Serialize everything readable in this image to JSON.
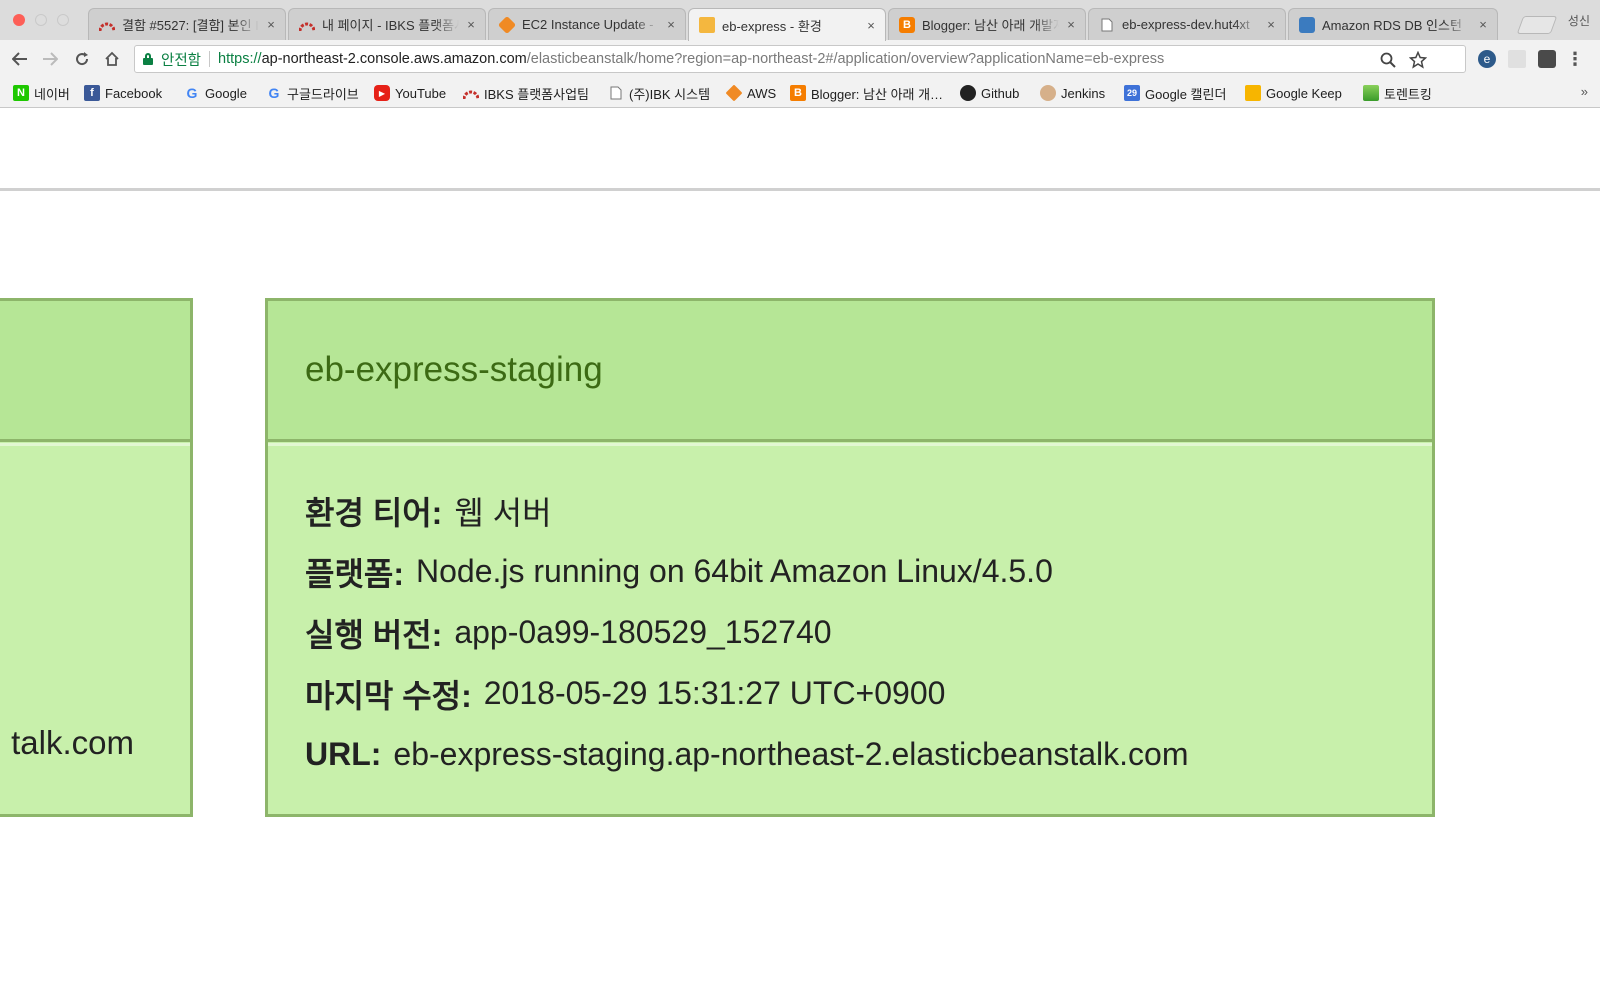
{
  "browser": {
    "tabs": [
      {
        "title": "결함 #5527: [결함] 본인 I",
        "favicon": "redmine-icon",
        "active": false
      },
      {
        "title": "내 페이지 - IBKS 플랫폼사",
        "favicon": "redmine-icon",
        "active": false
      },
      {
        "title": "EC2 Instance Update -",
        "favicon": "aws-icon",
        "active": false
      },
      {
        "title": "eb-express - 환경",
        "favicon": "beanstalk-icon",
        "active": true
      },
      {
        "title": "Blogger: 남산 아래 개발지",
        "favicon": "blogger-icon",
        "active": false
      },
      {
        "title": "eb-express-dev.hut4xt",
        "favicon": "page-icon",
        "active": false
      },
      {
        "title": "Amazon RDS DB 인스턴",
        "favicon": "rds-icon",
        "active": false
      }
    ],
    "close_glyph": "×",
    "profile_name": "성신",
    "address": {
      "secure_label": "안전함",
      "scheme": "https://",
      "host": "ap-northeast-2.console.aws.amazon.com",
      "path": "/elasticbeanstalk/home?region=ap-northeast-2#/application/overview?applicationName=eb-express"
    },
    "bookmarks": [
      {
        "label": "네이버",
        "icon": "naver-icon"
      },
      {
        "label": "Facebook",
        "icon": "facebook-icon"
      },
      {
        "label": "Google",
        "icon": "google-icon"
      },
      {
        "label": "구글드라이브",
        "icon": "google-icon"
      },
      {
        "label": "YouTube",
        "icon": "youtube-icon"
      },
      {
        "label": "IBKS 플랫폼사업팀",
        "icon": "redmine-icon"
      },
      {
        "label": "(주)IBK 시스템",
        "icon": "page-icon"
      },
      {
        "label": "AWS",
        "icon": "aws-icon"
      },
      {
        "label": "Blogger: 남산 아래 개…",
        "icon": "blogger-icon"
      },
      {
        "label": "Github",
        "icon": "github-icon"
      },
      {
        "label": "Jenkins",
        "icon": "jenkins-icon"
      },
      {
        "label": "Google 캘린더",
        "icon": "calendar-icon"
      },
      {
        "label": "Google Keep",
        "icon": "keep-icon"
      },
      {
        "label": "토렌트킹",
        "icon": "torrent-icon"
      }
    ],
    "bookmarks_overflow": "»"
  },
  "page": {
    "left_card": {
      "url_fragment": "talk.com"
    },
    "environment": {
      "name": "eb-express-staging",
      "fields": [
        {
          "key": "환경 티어:",
          "value": "웹 서버"
        },
        {
          "key": "플랫폼:",
          "value": "Node.js running on 64bit Amazon Linux/4.5.0"
        },
        {
          "key": "실행 버전:",
          "value": "app-0a99-180529_152740"
        },
        {
          "key": "마지막 수정:",
          "value": "2018-05-29 15:31:27 UTC+0900"
        },
        {
          "key": "URL:",
          "value": "eb-express-staging.ap-northeast-2.elasticbeanstalk.com"
        }
      ]
    }
  },
  "colors": {
    "card_bg": "#c8f0ab",
    "card_head_bg": "#b6e696",
    "card_border": "#8db56a",
    "env_name": "#3c6a14",
    "secure_green": "#0b8043"
  }
}
